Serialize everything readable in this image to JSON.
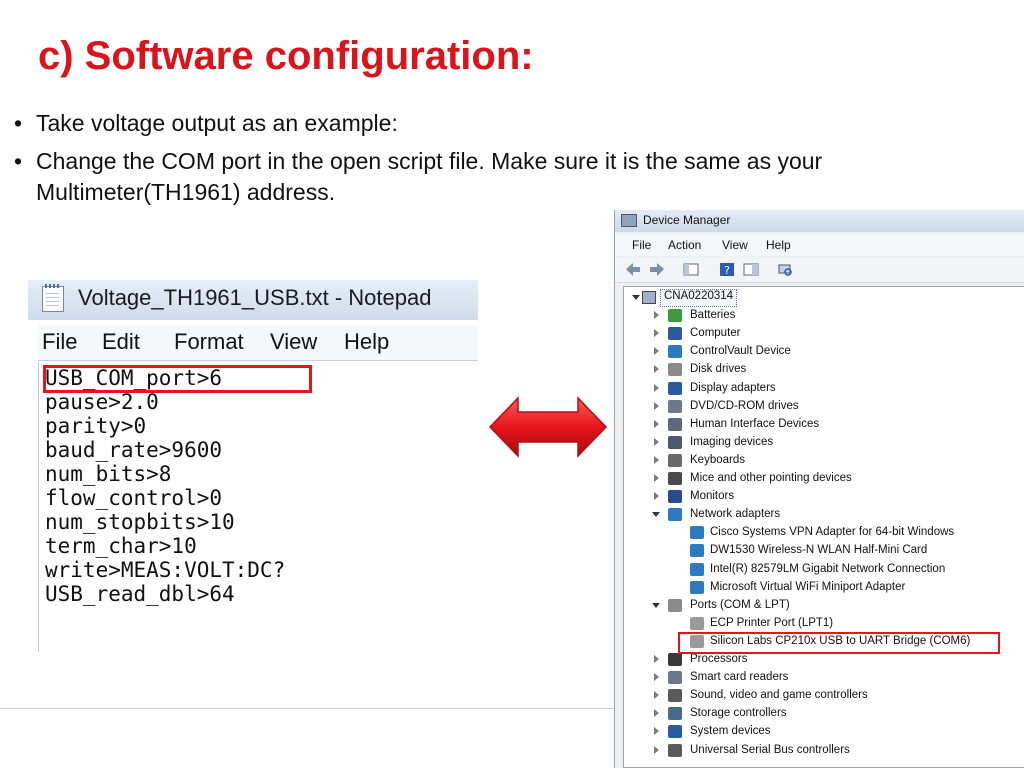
{
  "slide": {
    "title": "c) Software configuration:",
    "bullets": [
      "Take voltage output as an example:",
      "Change the COM port in the open script file. Make sure it is the same as your Multimeter(TH1961) address."
    ]
  },
  "notepad": {
    "title": "Voltage_TH1961_USB.txt - Notepad",
    "menu": [
      "File",
      "Edit",
      "Format",
      "View",
      "Help"
    ],
    "lines": [
      "USB_COM_port>6",
      "pause>2.0",
      "parity>0",
      "baud_rate>9600",
      "num_bits>8",
      "flow_control>0",
      "num_stopbits>10",
      "term_char>10",
      "write>MEAS:VOLT:DC?",
      "USB_read_dbl>64"
    ]
  },
  "device_manager": {
    "title": "Device Manager",
    "menu": [
      "File",
      "Action",
      "View",
      "Help"
    ],
    "root": "CNA0220314",
    "categories": [
      {
        "label": "Batteries",
        "icon": "battery-icon"
      },
      {
        "label": "Computer",
        "icon": "computer-icon"
      },
      {
        "label": "ControlVault Device",
        "icon": "device-icon"
      },
      {
        "label": "Disk drives",
        "icon": "disk-drive-icon"
      },
      {
        "label": "Display adapters",
        "icon": "display-adapter-icon"
      },
      {
        "label": "DVD/CD-ROM drives",
        "icon": "dvd-drive-icon"
      },
      {
        "label": "Human Interface Devices",
        "icon": "hid-icon"
      },
      {
        "label": "Imaging devices",
        "icon": "camera-icon"
      },
      {
        "label": "Keyboards",
        "icon": "keyboard-icon"
      },
      {
        "label": "Mice and other pointing devices",
        "icon": "mouse-icon"
      },
      {
        "label": "Monitors",
        "icon": "monitor-icon"
      },
      {
        "label": "Network adapters",
        "icon": "network-adapter-icon"
      },
      {
        "label": "Ports (COM & LPT)",
        "icon": "port-icon"
      },
      {
        "label": "Processors",
        "icon": "processor-icon"
      },
      {
        "label": "Smart card readers",
        "icon": "smart-card-icon"
      },
      {
        "label": "Sound, video and game controllers",
        "icon": "speaker-icon"
      },
      {
        "label": "Storage controllers",
        "icon": "storage-controller-icon"
      },
      {
        "label": "System devices",
        "icon": "system-device-icon"
      },
      {
        "label": "Universal Serial Bus controllers",
        "icon": "usb-icon"
      }
    ],
    "network_adapters": [
      "Cisco Systems VPN Adapter for 64-bit Windows",
      "DW1530 Wireless-N WLAN Half-Mini Card",
      "Intel(R) 82579LM Gigabit Network Connection",
      "Microsoft Virtual WiFi Miniport Adapter"
    ],
    "ports": [
      "ECP Printer Port (LPT1)",
      "Silicon Labs CP210x USB to UART Bridge (COM6)"
    ]
  },
  "colors": {
    "title_red": "#d9141b",
    "highlight_red": "#e8141c",
    "arrow_red": "#e8141c"
  }
}
